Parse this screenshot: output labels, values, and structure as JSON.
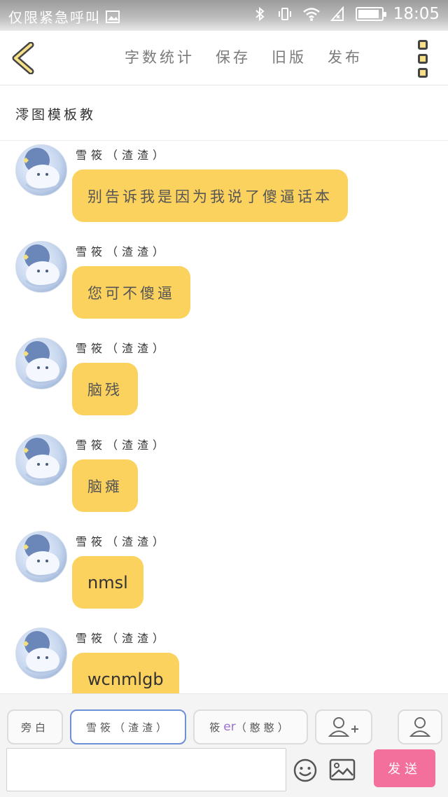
{
  "status_bar": {
    "left_text": "仅限紧急呼叫",
    "time": "18:05",
    "battery_level": 0.9
  },
  "toolbar": {
    "actions": [
      {
        "label": "字数统计"
      },
      {
        "label": "保存"
      },
      {
        "label": "旧版"
      },
      {
        "label": "发布"
      }
    ]
  },
  "page": {
    "title": "澪图模板教"
  },
  "messages": [
    {
      "sender": "雪筱（渣渣）",
      "text": "别告诉我是因为我说了傻逼话本"
    },
    {
      "sender": "雪筱（渣渣）",
      "text": "您可不傻逼"
    },
    {
      "sender": "雪筱（渣渣）",
      "text": "脑残"
    },
    {
      "sender": "雪筱（渣渣）",
      "text": "脑瘫"
    },
    {
      "sender": "雪筱（渣渣）",
      "text": "nmsl"
    },
    {
      "sender": "雪筱（渣渣）",
      "text": "wcnmlgb"
    }
  ],
  "roles": {
    "narrator": "旁白",
    "active": "雪筱（渣渣）",
    "other_prefix": "筱",
    "other_er": "er",
    "other_suffix": "（憨憨）"
  },
  "input": {
    "value": "",
    "send_label": "发送"
  },
  "colors": {
    "bubble": "#fcd25f",
    "send_button": "#f4709c",
    "active_role_border": "#6f8fd6"
  }
}
